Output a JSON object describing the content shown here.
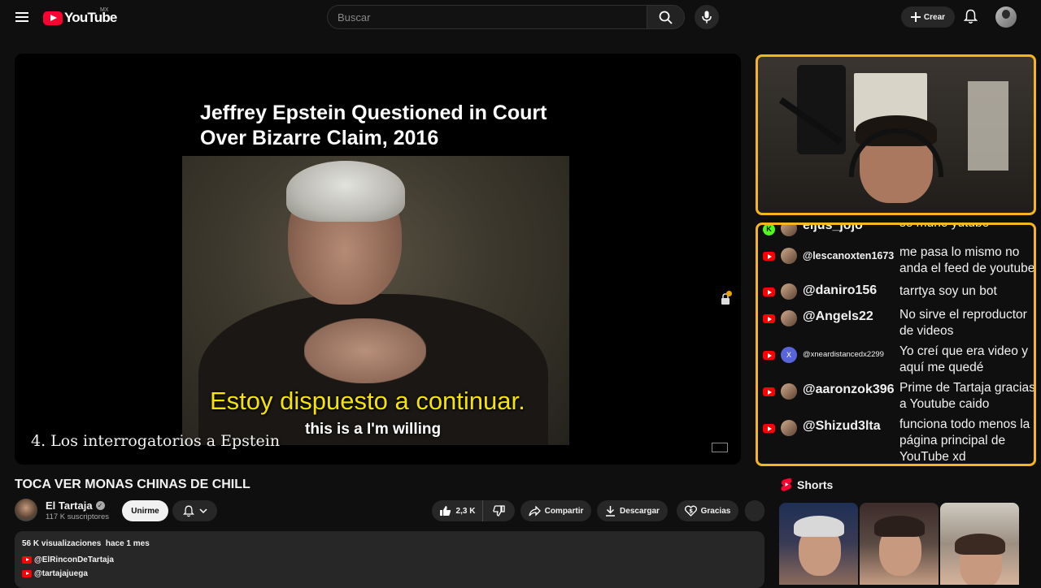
{
  "header": {
    "logo_text": "YouTube",
    "region": "MX",
    "search_placeholder": "Buscar",
    "create_label": "Crear"
  },
  "player": {
    "clip_title_line1": "Jeffrey Epstein Questioned in Court",
    "clip_title_line2": "Over Bizarre Claim, 2016",
    "subtitle_es": "Estoy dispuesto a continuar.",
    "subtitle_en": "this is a I'm willing",
    "chapter": "4. Los interrogatorios a Epstein"
  },
  "chat": {
    "messages": [
      {
        "platform": "kick",
        "user": "eljus_jojo",
        "text": "se murio yutube"
      },
      {
        "platform": "youtube",
        "user": "@lescanoxten1673",
        "text": "me pasa lo mismo no anda el feed de youtube"
      },
      {
        "platform": "youtube",
        "user": "@daniro156",
        "text": "tarrtya soy un bot"
      },
      {
        "platform": "youtube",
        "user": "@Angels22",
        "text": "No sirve el reproductor de videos"
      },
      {
        "platform": "youtube",
        "user": "@xneardistancedx2299",
        "text": "Yo creí que era video y aquí me quedé"
      },
      {
        "platform": "youtube",
        "user": "@aaronzok396",
        "text": "Prime de Tartaja gracias a Youtube caido"
      },
      {
        "platform": "youtube",
        "user": "@Shizud3lta",
        "text": "funciona todo menos la página principal de YouTube xd"
      }
    ],
    "avatar_x_letter": "X"
  },
  "video": {
    "title": "TOCA VER MONAS CHINAS DE CHILL",
    "channel_name": "El Tartaja",
    "subscribers": "117 K suscriptores",
    "join_label": "Unirme",
    "likes": "2,3 K",
    "share_label": "Compartir",
    "download_label": "Descargar",
    "thanks_label": "Gracias"
  },
  "description": {
    "views": "56 K visualizaciones",
    "date": "hace 1 mes",
    "links": [
      "@ElRinconDeTartaja",
      "@tartajajuega"
    ]
  },
  "shorts": {
    "heading": "Shorts"
  },
  "colors": {
    "background": "#0f0f0f",
    "overlay_border": "#f5b51e",
    "youtube_red": "#ff0000",
    "subtitle_yellow": "#f5e400"
  }
}
